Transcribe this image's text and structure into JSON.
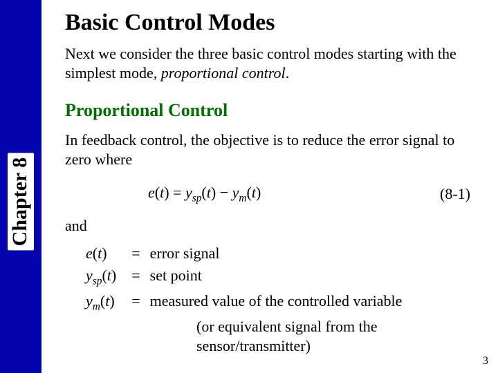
{
  "chapter_label": "Chapter 8",
  "title": "Basic Control Modes",
  "intro_prefix": "Next we consider the three basic control modes starting with the simplest mode, ",
  "intro_em": "proportional control",
  "intro_suffix": ".",
  "section_heading": "Proportional Control",
  "body1": "In feedback control, the objective is to reduce the error signal to zero where",
  "equation": {
    "lhs": "e(t)",
    "eq": "=",
    "r1": "y_sp(t)",
    "minus": "−",
    "r2": "y_m(t)",
    "label": "(8-1)"
  },
  "and": "and",
  "defs": [
    {
      "sym": "e(t)",
      "desc": "error signal"
    },
    {
      "sym": "y_sp(t)",
      "desc": "set point"
    },
    {
      "sym": "y_m(t)",
      "desc": "measured value of the controlled variable"
    }
  ],
  "defs_extra": "(or equivalent signal from the sensor/transmitter)",
  "page_number": "3"
}
